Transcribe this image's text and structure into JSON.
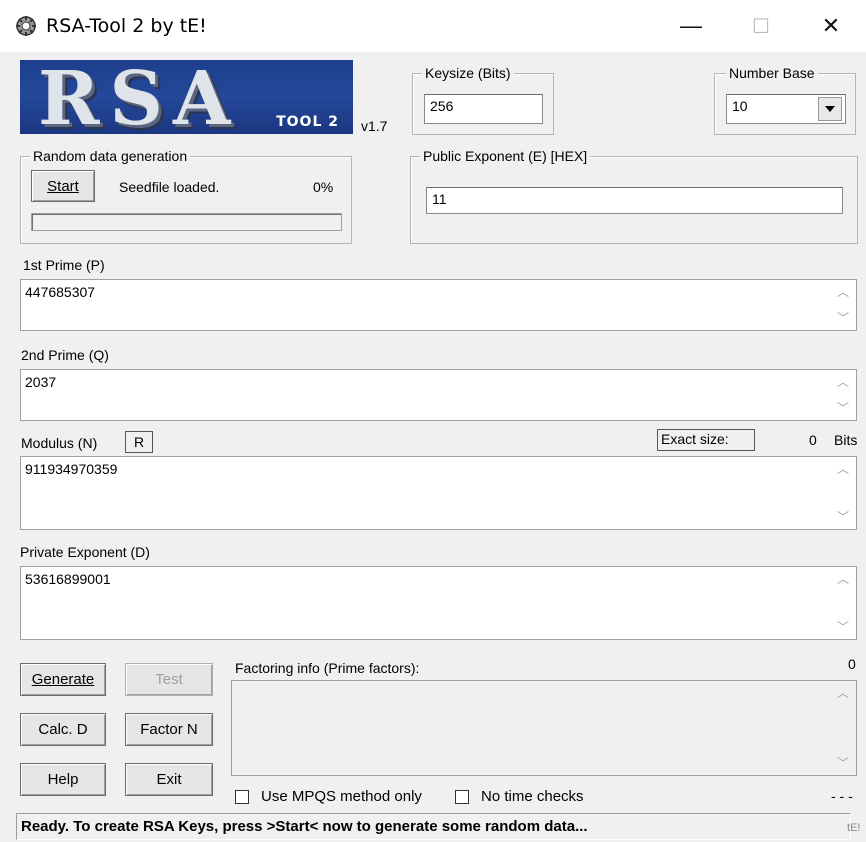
{
  "window": {
    "title": "RSA-Tool 2 by tE!",
    "minimize_glyph": "—",
    "maximize_glyph": "☐",
    "close_glyph": "✕"
  },
  "logo": {
    "main_text": "RSA",
    "tool_text": "TOOL 2",
    "version": "v1.7"
  },
  "keysize": {
    "legend": "Keysize (Bits)",
    "value": "256"
  },
  "number_base": {
    "legend": "Number Base",
    "selected": "10"
  },
  "random": {
    "legend": "Random data generation",
    "start_label": "Start",
    "status": "Seedfile loaded.",
    "percent": "0%",
    "progress_fraction": 0
  },
  "public_exponent": {
    "legend": "Public Exponent (E) [HEX]",
    "value": "11"
  },
  "prime_p": {
    "label": "1st Prime (P)",
    "value": "447685307"
  },
  "prime_q": {
    "label": "2nd Prime (Q)",
    "value": "2037"
  },
  "modulus": {
    "label": "Modulus (N)",
    "r_button": "R",
    "exact_size_label": "Exact size:",
    "size_value": "0",
    "size_unit": "Bits",
    "value": "911934970359"
  },
  "private_exponent": {
    "label": "Private Exponent (D)",
    "value": "53616899001"
  },
  "buttons": {
    "generate": "Generate",
    "test": "Test",
    "calc_d": "Calc. D",
    "factor_n": "Factor N",
    "help": "Help",
    "exit": "Exit"
  },
  "factoring": {
    "label": "Factoring info (Prime factors):",
    "count": "0",
    "value": ""
  },
  "options": {
    "mpqs_label": "Use MPQS method only",
    "no_time_label": "No time checks",
    "dashes": "- - -"
  },
  "status": {
    "text": "Ready. To create RSA Keys, press >Start< now to generate some random data...",
    "corner": "tE!"
  },
  "icons": [
    "app-icon",
    "combo-arrow-icon",
    "scroll-up-icon",
    "scroll-down-icon"
  ]
}
